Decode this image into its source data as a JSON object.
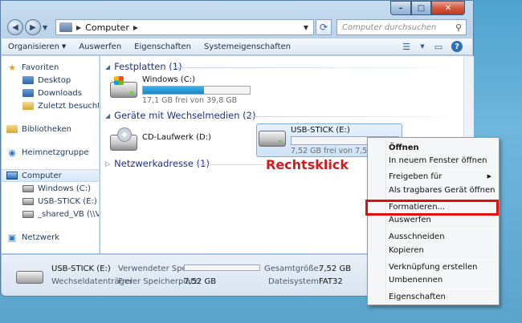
{
  "titlebar": {
    "min": "–",
    "max": "□",
    "close": "✕"
  },
  "address": {
    "path": "Computer",
    "search_placeholder": "Computer durchsuchen"
  },
  "toolbar": {
    "items": [
      "Organisieren",
      "Auswerfen",
      "Eigenschaften",
      "Systemeigenschaften"
    ]
  },
  "sidebar": {
    "favorites": "Favoriten",
    "fav_items": [
      "Desktop",
      "Downloads",
      "Zuletzt besucht"
    ],
    "libraries": "Bibliotheken",
    "homegroup": "Heimnetzgruppe",
    "computer": "Computer",
    "computer_items": [
      "Windows (C:)",
      "USB-STICK (E:)",
      "_shared_VB (\\\\VBoxS"
    ],
    "network": "Netzwerk"
  },
  "content": {
    "group1": "Festplatten (1)",
    "group2": "Geräte mit Wechselmedien (2)",
    "group3": "Netzwerkadresse (1)",
    "drive_c": {
      "name": "Windows (C:)",
      "free": "17,1 GB frei von 39,8 GB",
      "used_fraction": 0.57
    },
    "drive_d": {
      "name": "CD-Laufwerk (D:)"
    },
    "drive_e": {
      "name": "USB-STICK (E:)",
      "free": "7,52 GB frei von 7,52 GB",
      "used_fraction": 0.0
    }
  },
  "annotation": "Rechtsklick",
  "details": {
    "name": "USB-STICK (E:)",
    "type": "Wechseldatenträger",
    "used_label": "Verwendeter Speic...",
    "free_label": "Freier Speicherplatz:",
    "free_value": "7,52 GB",
    "total_label": "Gesamtgröße:",
    "total_value": "7,52 GB",
    "fs_label": "Dateisystem:",
    "fs_value": "FAT32"
  },
  "context_menu": {
    "items": [
      "Öffnen",
      "In neuem Fenster öffnen",
      "Freigeben für",
      "Als tragbares Gerät öffnen",
      "Formatieren...",
      "Auswerfen",
      "Ausschneiden",
      "Kopieren",
      "Verknüpfung erstellen",
      "Umbenennen",
      "Eigenschaften"
    ]
  },
  "colors": {
    "accent_red": "#e01010",
    "group_head": "#1e3287",
    "bar_fill": "#1a86c9"
  }
}
